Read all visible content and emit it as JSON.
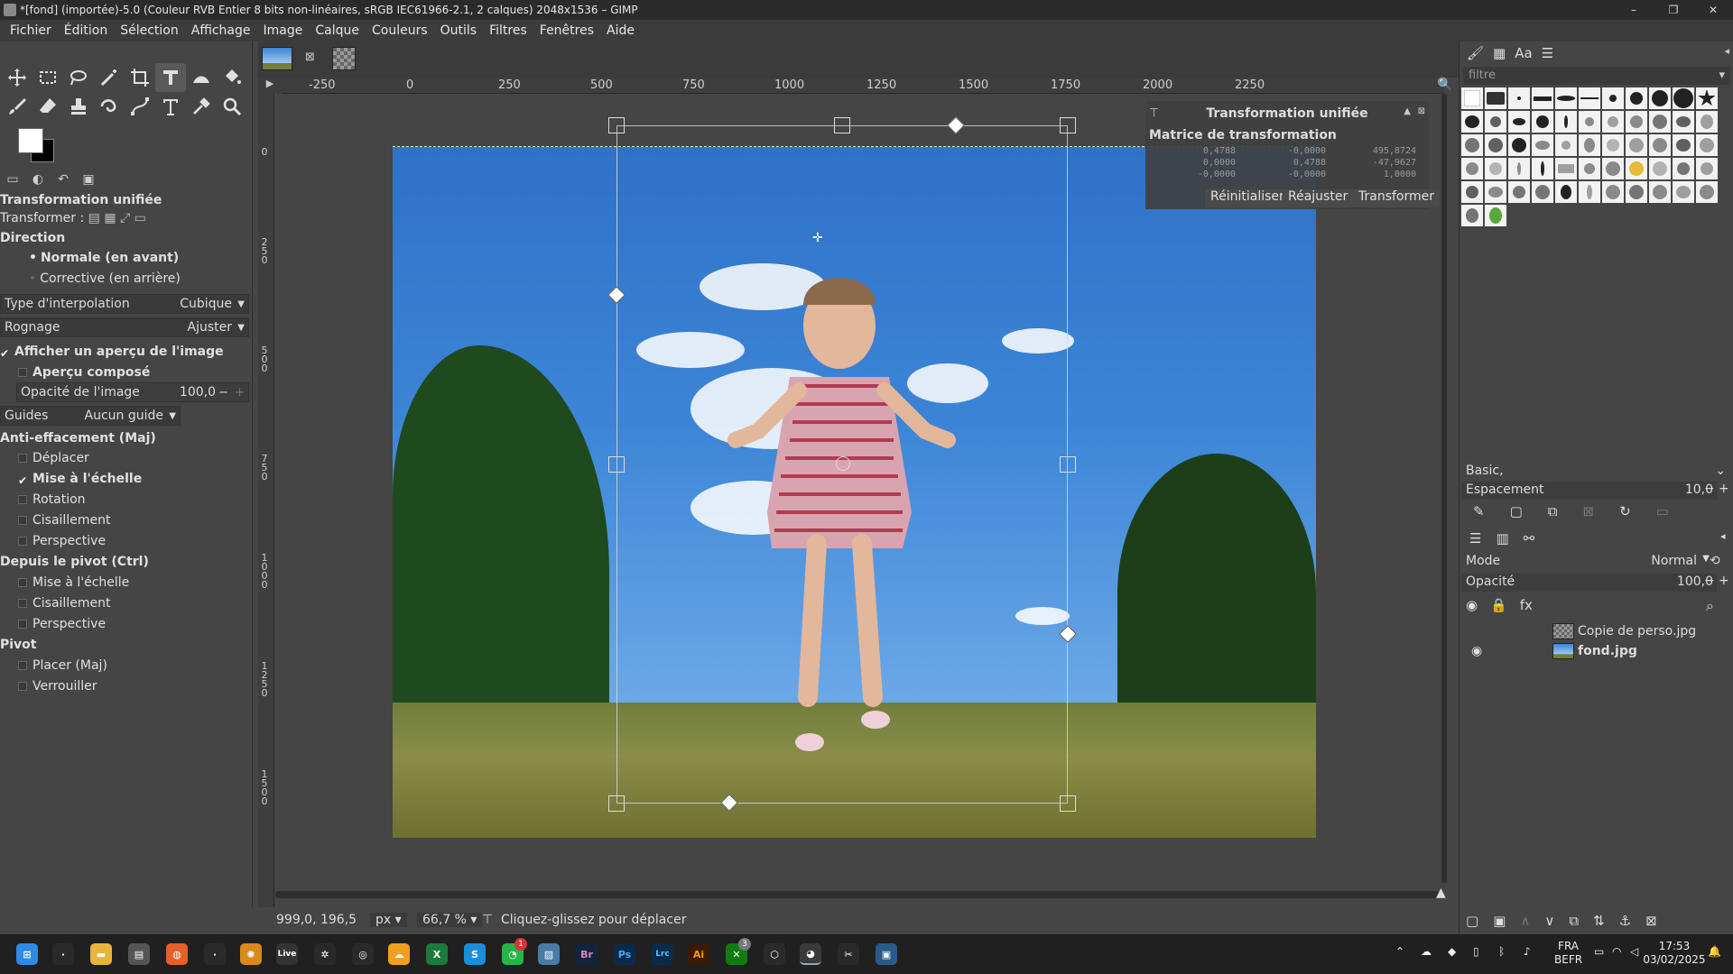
{
  "window": {
    "title": "*[fond] (importée)-5.0 (Couleur RVB Entier 8 bits non-linéaires, sRGB IEC61966-2.1, 2 calques) 2048x1536 – GIMP",
    "controls": [
      "–",
      "❐",
      "✕"
    ]
  },
  "menu": [
    "Fichier",
    "Édition",
    "Sélection",
    "Affichage",
    "Image",
    "Calque",
    "Couleurs",
    "Outils",
    "Filtres",
    "Fenêtres",
    "Aide"
  ],
  "tool_options": {
    "title": "Transformation unifiée",
    "transform_label": "Transformer :",
    "direction_label": "Direction",
    "direction_forward": "Normale (en avant)",
    "direction_backward": "Corrective (en arrière)",
    "interpolation_label": "Type d'interpolation",
    "interpolation_value": "Cubique",
    "clipping_label": "Rognage",
    "clipping_value": "Ajuster",
    "show_preview": "Afficher un aperçu de l'image",
    "composite_preview": "Aperçu composé",
    "image_opacity_label": "Opacité de l'image",
    "image_opacity_value": "100,0",
    "guides_label": "Guides",
    "guides_value": "Aucun guide",
    "constrain_label": "Anti-effacement (Maj)",
    "constrain_move": "Déplacer",
    "constrain_scale": "Mise à l'échelle",
    "constrain_rotate": "Rotation",
    "constrain_shear": "Cisaillement",
    "constrain_perspective": "Perspective",
    "pivot_label": "Depuis le pivot (Ctrl)",
    "pivot_scale": "Mise à l'échelle",
    "pivot_shear": "Cisaillement",
    "pivot_perspective": "Perspective",
    "pivot_section": "Pivot",
    "pivot_snap": "Placer (Maj)",
    "pivot_lock": "Verrouiller"
  },
  "rulers": {
    "h_ticks": [
      "-250",
      "0",
      "250",
      "500",
      "750",
      "1000",
      "1250",
      "1500",
      "1750",
      "2000",
      "2250"
    ],
    "v_ticks": [
      "0",
      "2\n5\n0",
      "5\n0\n0",
      "7\n5\n0",
      "1\n0\n0\n0",
      "1\n2\n5\n0",
      "1\n5\n0\n0"
    ]
  },
  "transform_dialog": {
    "title": "Transformation unifiée",
    "subtitle": "Matrice de transformation",
    "matrix": [
      [
        "0,4788",
        "-0,0000",
        "495,8724"
      ],
      [
        "0,0000",
        "0,4788",
        "-47,9627"
      ],
      [
        "-0,0000",
        "-0,0000",
        "1,0000"
      ]
    ],
    "buttons": [
      "Réinitialiser",
      "Réajuster",
      "Transformer"
    ]
  },
  "status": {
    "coords": "999,0, 196,5",
    "unit": "px",
    "zoom": "66,7 %",
    "message": "Cliquez-glissez pour déplacer"
  },
  "right_dock": {
    "filter_placeholder": "filtre",
    "brush_set": "Basic,",
    "spacing_label": "Espacement",
    "spacing_value": "10,0",
    "mode_label": "Mode",
    "mode_value": "Normal",
    "opacity_label": "Opacité",
    "opacity_value": "100,0",
    "layers": [
      {
        "name": "Copie de perso.jpg",
        "visible": false
      },
      {
        "name": "fond.jpg",
        "visible": true
      }
    ]
  },
  "taskbar": {
    "apps": [
      "Live",
      "Br",
      "Ps",
      "Lrc",
      "Ai"
    ],
    "tray_lang_1": "FRA",
    "tray_lang_2": "BEFR",
    "time": "17:53",
    "date": "03/02/2025",
    "badge_whatsapp": "1",
    "badge_xbox": "3"
  },
  "colors": {
    "accent": "#3c85d6",
    "dock_bg": "#454545"
  }
}
